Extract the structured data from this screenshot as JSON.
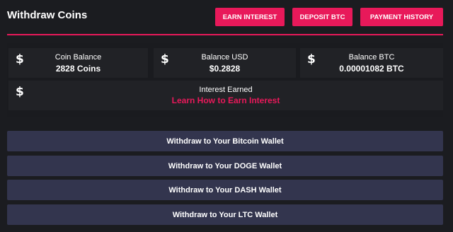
{
  "header": {
    "title": "Withdraw Coins",
    "buttons": {
      "earn_interest": "EARN INTEREST",
      "deposit_btc": "DEPOSIT BTC",
      "payment_history": "PAYMENT HISTORY"
    }
  },
  "colors": {
    "accent": "#e8195a",
    "background": "#1b1c20",
    "card": "#212226",
    "withdraw_button": "#33354e"
  },
  "balances": {
    "coin": {
      "icon": "$",
      "label": "Coin Balance",
      "value": "2828 Coins"
    },
    "usd": {
      "icon": "$",
      "label": "Balance USD",
      "value": "$0.2828"
    },
    "btc": {
      "icon": "$",
      "label": "Balance BTC",
      "value": "0.00001082 BTC"
    },
    "interest": {
      "icon": "$",
      "label": "Interest Earned",
      "link": "Learn How to Earn Interest"
    }
  },
  "withdraw": {
    "bitcoin": "Withdraw to Your Bitcoin Wallet",
    "doge": "Withdraw to Your DOGE Wallet",
    "dash": "Withdraw to Your DASH Wallet",
    "ltc": "Withdraw to Your LTC Wallet"
  }
}
